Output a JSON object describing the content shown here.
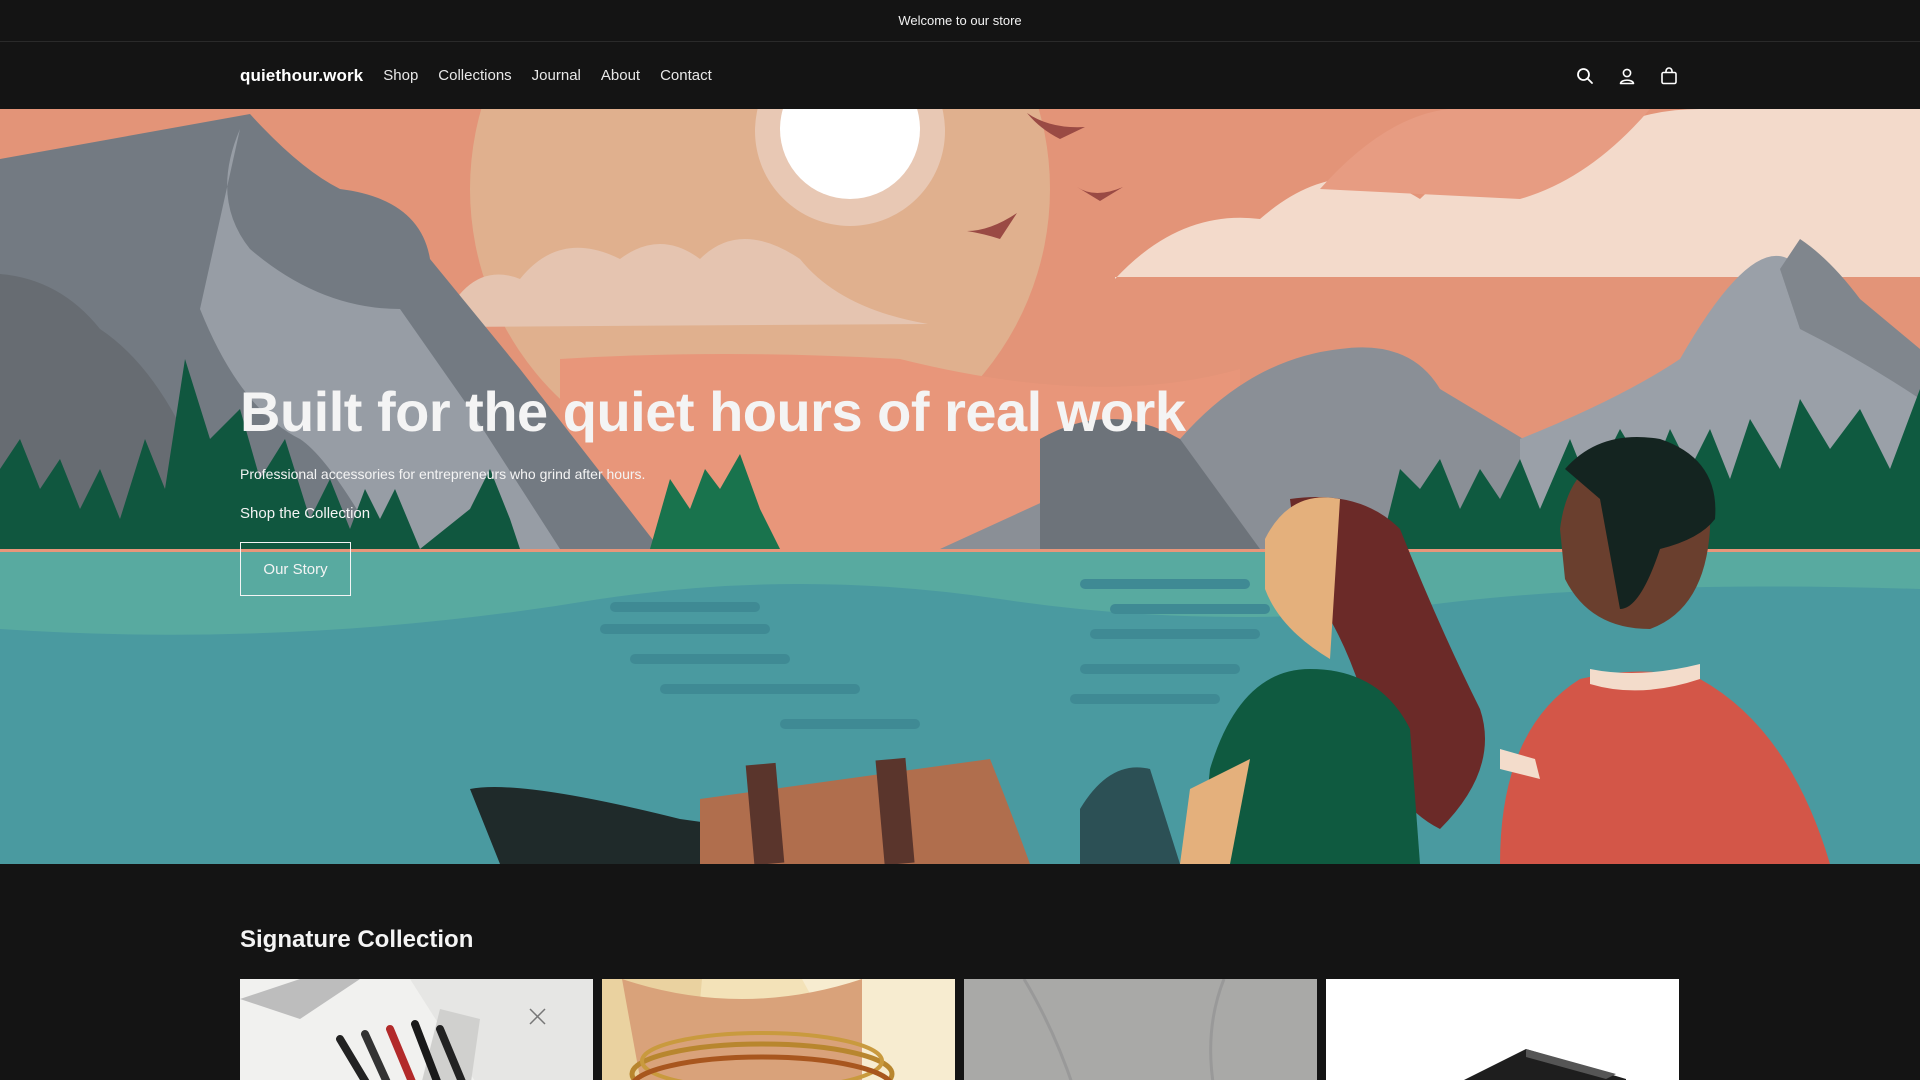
{
  "announcement": "Welcome to our store",
  "header": {
    "logo": "quiethour.work",
    "nav": [
      "Shop",
      "Collections",
      "Journal",
      "About",
      "Contact"
    ],
    "icons": [
      "search-icon",
      "account-icon",
      "cart-icon"
    ]
  },
  "hero": {
    "title": "Built for the quiet hours of real work",
    "subtitle": "Professional accessories for entrepreneurs who grind after hours.",
    "link_label": "Shop the Collection",
    "button_label": "Our Story"
  },
  "collection": {
    "title": "Signature Collection",
    "products": [
      {
        "image": "pens-image"
      },
      {
        "image": "bracelets-image"
      },
      {
        "image": "grey-item-image"
      },
      {
        "image": "dark-product-image"
      }
    ]
  },
  "colors": {
    "background": "#141414",
    "sky": "#e8967a",
    "water": "#4a9aa0",
    "trees": "#0f5a40"
  }
}
